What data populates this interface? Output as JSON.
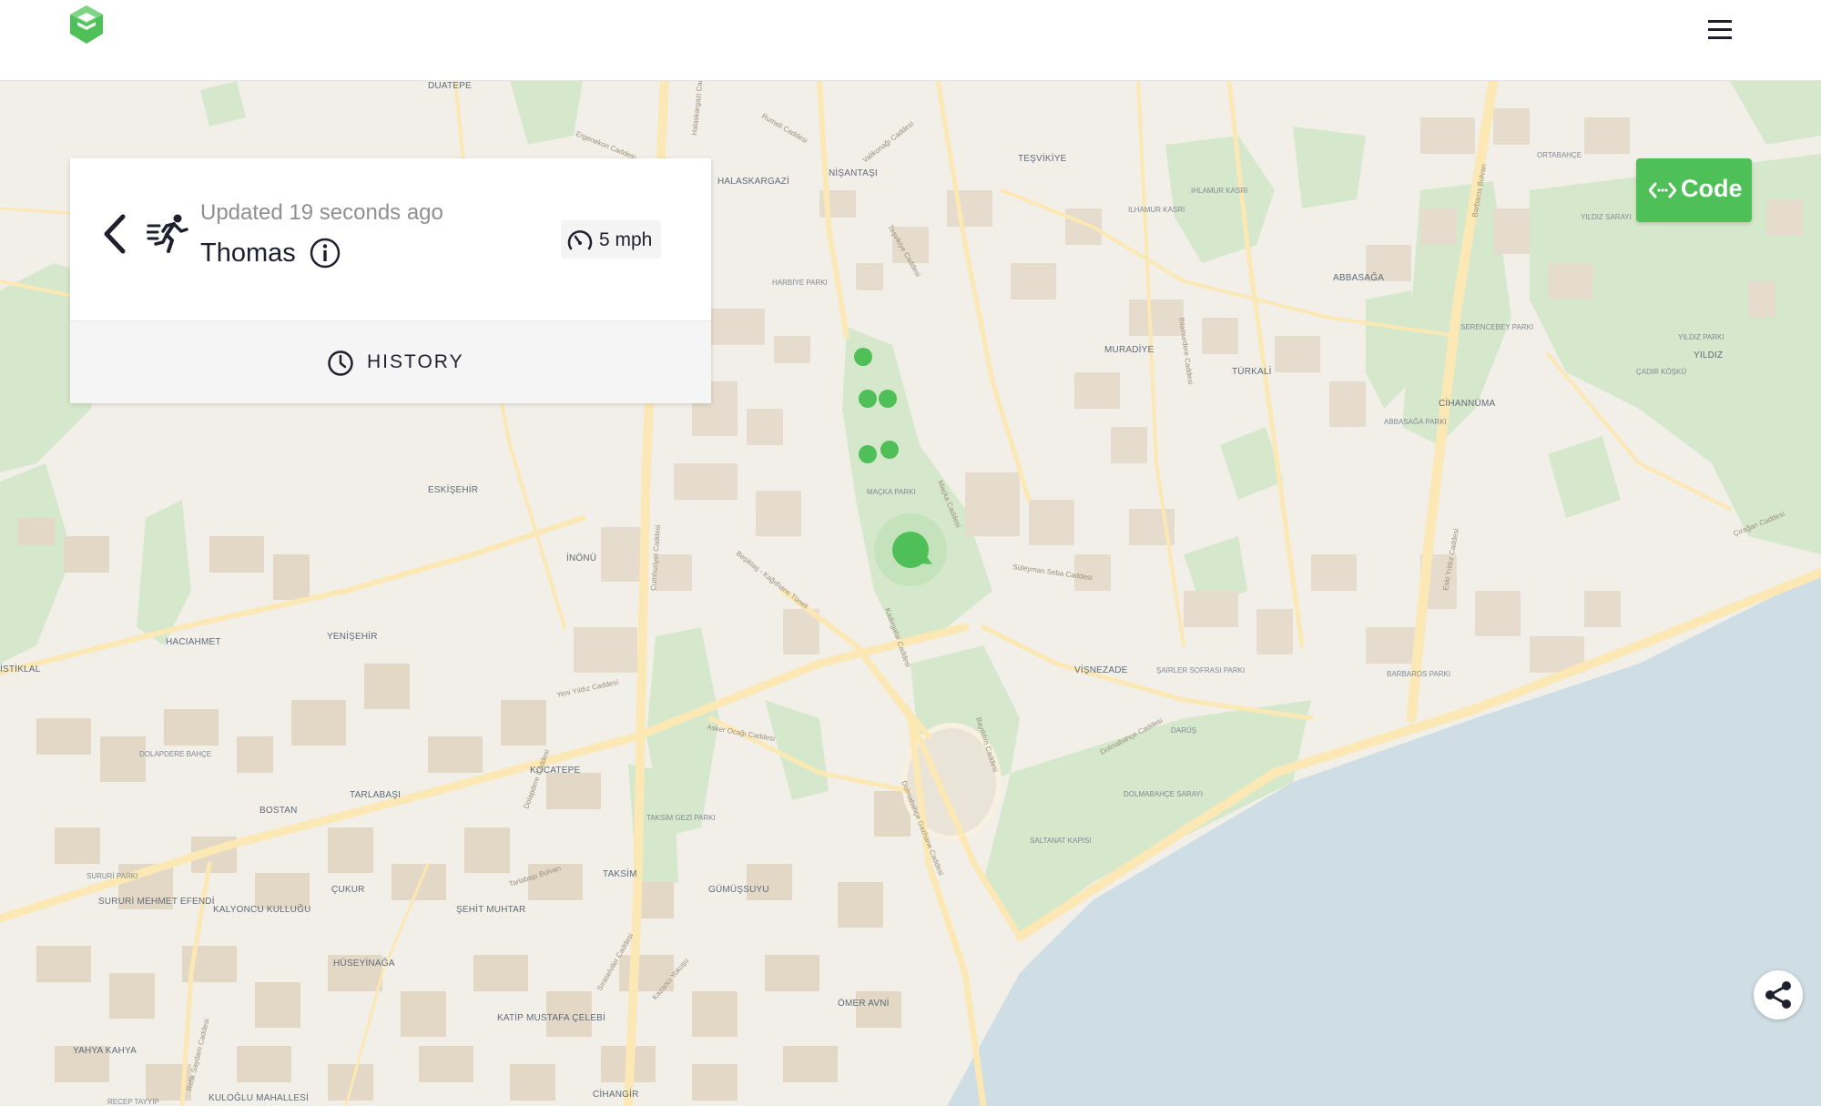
{
  "header": {
    "logo_icon": "cube-logo-icon",
    "menu_icon": "hamburger-menu-icon"
  },
  "tracker_card": {
    "back_icon": "chevron-left-icon",
    "activity_icon": "running-person-icon",
    "updated_text": "Updated 19 seconds ago",
    "name": "Thomas",
    "info_icon": "info-icon",
    "speed_icon": "speedometer-icon",
    "speed": "5 mph",
    "history_icon": "clock-icon",
    "history_label": "HISTORY"
  },
  "code_button": {
    "icon": "code-icon",
    "label": "Code"
  },
  "share_button": {
    "icon": "share-icon"
  },
  "map": {
    "colors": {
      "land": "#f2efe9",
      "water": "#cfdee4",
      "park": "#d6e8cc",
      "road": "#fbe8b4",
      "building": "#e6dccd",
      "marker": "#4fbf57"
    },
    "places": [
      "DUATEPE",
      "HALASKARGAZİ",
      "NİŞANTAŞI",
      "TEŞVİKİYE",
      "ABBASAĞA",
      "MURADİYE",
      "TÜRKALİ",
      "CİHANNÜMA",
      "YILDIZ",
      "ESKİŞEHİR",
      "İNÖNÜ",
      "HACIAHMET",
      "YENİŞEHİR",
      "KOCATEPE",
      "TARLABAŞI",
      "BOSTAN",
      "ÇUKUR",
      "TAKSİM",
      "GÜMÜŞSUYU",
      "ŞEHİT MUHTAR",
      "HÜSEYİNAĞA",
      "KATİP MUSTAFA ÇELEBİ",
      "YAHYA KAHYA",
      "CİHANGİR",
      "ÖMER AVNİ",
      "VİŞNEZADE",
      "KALYONCU KULLUĞU",
      "SURURİ MEHMET EFENDİ",
      "İSTİKLAL",
      "KULOĞLU MAHALLESİ",
      "DOLAPDERE BAHÇE",
      "SURURİ PARKI",
      "MAÇKA PARKI",
      "HARBİYE PARKI",
      "TAKSİM GEZİ PARKI",
      "ABBASAĞA PARKI",
      "SERENCEBEY PARKI",
      "YILDIZ PARKI",
      "ÇADIR KÖŞKÜ",
      "YILDIZ SARAYI",
      "ORTABAHÇE",
      "ILHAMUR KASRI",
      "IHLAMUR KASRI",
      "BARBAROS PARKI",
      "DOLMABAHÇE SARAYI",
      "SALTANAT KAPISI",
      "DARÜŞ",
      "ŞAİRLER SOFRASI PARKI",
      "RECEP TAYYİP"
    ],
    "roads": [
      "Cumhuriyet Caddesi",
      "Barbaros Bulvarı",
      "Çırağan Caddesi",
      "Dolmabahçe Caddesi",
      "Süleyman Seba Caddesi",
      "Tarlabaşı Bulvarı",
      "Halaskargazi Caddesi",
      "Asker Ocağı Caddesi",
      "Eski Yıldız Caddesi",
      "Beşiktaş - Kağıthane Tüneli",
      "Kadırgalar Caddesi",
      "Dolmabahçe Gazhane Caddesi",
      "Refik Saydam Caddesi",
      "Sıraselviler Caddesi",
      "Valikonağı Caddesi",
      "Teşvikiye Caddesi",
      "Ihlamurdere Caddesi",
      "Rumeli Caddesi",
      "Ergenekon Caddesi",
      "Maçka Caddesi",
      "Yeni Yıldız Caddesi",
      "Bayıldım Caddesi",
      "Kazancı Yokuşu",
      "Dolapdere Caddesi"
    ]
  }
}
